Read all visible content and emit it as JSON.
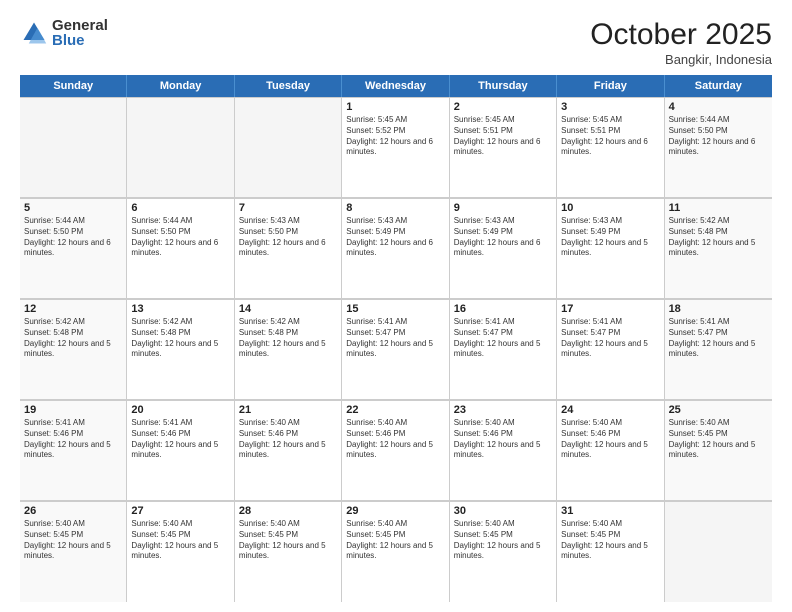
{
  "logo": {
    "general": "General",
    "blue": "Blue"
  },
  "header": {
    "month": "October 2025",
    "location": "Bangkir, Indonesia"
  },
  "weekdays": [
    "Sunday",
    "Monday",
    "Tuesday",
    "Wednesday",
    "Thursday",
    "Friday",
    "Saturday"
  ],
  "weeks": [
    [
      {
        "day": "",
        "empty": true
      },
      {
        "day": "",
        "empty": true
      },
      {
        "day": "",
        "empty": true
      },
      {
        "day": "1",
        "sunrise": "5:45 AM",
        "sunset": "5:52 PM",
        "daylight": "12 hours and 6 minutes."
      },
      {
        "day": "2",
        "sunrise": "5:45 AM",
        "sunset": "5:51 PM",
        "daylight": "12 hours and 6 minutes."
      },
      {
        "day": "3",
        "sunrise": "5:45 AM",
        "sunset": "5:51 PM",
        "daylight": "12 hours and 6 minutes."
      },
      {
        "day": "4",
        "sunrise": "5:44 AM",
        "sunset": "5:50 PM",
        "daylight": "12 hours and 6 minutes."
      }
    ],
    [
      {
        "day": "5",
        "sunrise": "5:44 AM",
        "sunset": "5:50 PM",
        "daylight": "12 hours and 6 minutes."
      },
      {
        "day": "6",
        "sunrise": "5:44 AM",
        "sunset": "5:50 PM",
        "daylight": "12 hours and 6 minutes."
      },
      {
        "day": "7",
        "sunrise": "5:43 AM",
        "sunset": "5:50 PM",
        "daylight": "12 hours and 6 minutes."
      },
      {
        "day": "8",
        "sunrise": "5:43 AM",
        "sunset": "5:49 PM",
        "daylight": "12 hours and 6 minutes."
      },
      {
        "day": "9",
        "sunrise": "5:43 AM",
        "sunset": "5:49 PM",
        "daylight": "12 hours and 6 minutes."
      },
      {
        "day": "10",
        "sunrise": "5:43 AM",
        "sunset": "5:49 PM",
        "daylight": "12 hours and 5 minutes."
      },
      {
        "day": "11",
        "sunrise": "5:42 AM",
        "sunset": "5:48 PM",
        "daylight": "12 hours and 5 minutes."
      }
    ],
    [
      {
        "day": "12",
        "sunrise": "5:42 AM",
        "sunset": "5:48 PM",
        "daylight": "12 hours and 5 minutes."
      },
      {
        "day": "13",
        "sunrise": "5:42 AM",
        "sunset": "5:48 PM",
        "daylight": "12 hours and 5 minutes."
      },
      {
        "day": "14",
        "sunrise": "5:42 AM",
        "sunset": "5:48 PM",
        "daylight": "12 hours and 5 minutes."
      },
      {
        "day": "15",
        "sunrise": "5:41 AM",
        "sunset": "5:47 PM",
        "daylight": "12 hours and 5 minutes."
      },
      {
        "day": "16",
        "sunrise": "5:41 AM",
        "sunset": "5:47 PM",
        "daylight": "12 hours and 5 minutes."
      },
      {
        "day": "17",
        "sunrise": "5:41 AM",
        "sunset": "5:47 PM",
        "daylight": "12 hours and 5 minutes."
      },
      {
        "day": "18",
        "sunrise": "5:41 AM",
        "sunset": "5:47 PM",
        "daylight": "12 hours and 5 minutes."
      }
    ],
    [
      {
        "day": "19",
        "sunrise": "5:41 AM",
        "sunset": "5:46 PM",
        "daylight": "12 hours and 5 minutes."
      },
      {
        "day": "20",
        "sunrise": "5:41 AM",
        "sunset": "5:46 PM",
        "daylight": "12 hours and 5 minutes."
      },
      {
        "day": "21",
        "sunrise": "5:40 AM",
        "sunset": "5:46 PM",
        "daylight": "12 hours and 5 minutes."
      },
      {
        "day": "22",
        "sunrise": "5:40 AM",
        "sunset": "5:46 PM",
        "daylight": "12 hours and 5 minutes."
      },
      {
        "day": "23",
        "sunrise": "5:40 AM",
        "sunset": "5:46 PM",
        "daylight": "12 hours and 5 minutes."
      },
      {
        "day": "24",
        "sunrise": "5:40 AM",
        "sunset": "5:46 PM",
        "daylight": "12 hours and 5 minutes."
      },
      {
        "day": "25",
        "sunrise": "5:40 AM",
        "sunset": "5:45 PM",
        "daylight": "12 hours and 5 minutes."
      }
    ],
    [
      {
        "day": "26",
        "sunrise": "5:40 AM",
        "sunset": "5:45 PM",
        "daylight": "12 hours and 5 minutes."
      },
      {
        "day": "27",
        "sunrise": "5:40 AM",
        "sunset": "5:45 PM",
        "daylight": "12 hours and 5 minutes."
      },
      {
        "day": "28",
        "sunrise": "5:40 AM",
        "sunset": "5:45 PM",
        "daylight": "12 hours and 5 minutes."
      },
      {
        "day": "29",
        "sunrise": "5:40 AM",
        "sunset": "5:45 PM",
        "daylight": "12 hours and 5 minutes."
      },
      {
        "day": "30",
        "sunrise": "5:40 AM",
        "sunset": "5:45 PM",
        "daylight": "12 hours and 5 minutes."
      },
      {
        "day": "31",
        "sunrise": "5:40 AM",
        "sunset": "5:45 PM",
        "daylight": "12 hours and 5 minutes."
      },
      {
        "day": "",
        "empty": true
      }
    ]
  ]
}
